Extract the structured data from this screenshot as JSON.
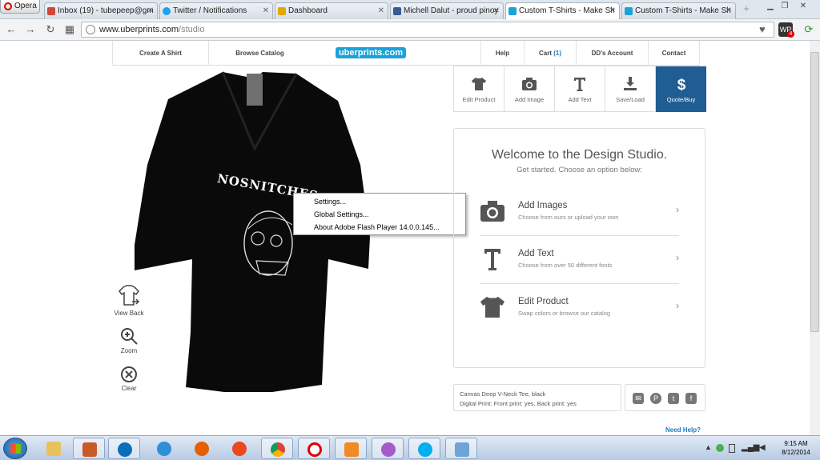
{
  "browser": {
    "menu_label": "Opera",
    "tabs": [
      {
        "title": "Inbox (19) - tubepeep@gm",
        "color": "#d44638"
      },
      {
        "title": "Twitter / Notifications",
        "color": "#1da1f2"
      },
      {
        "title": "Dashboard",
        "color": "#e0a800"
      },
      {
        "title": "Michell Dalut - proud pinoy",
        "color": "#3b5998"
      },
      {
        "title": "Custom T-Shirts - Make Sh",
        "color": "#1aa3d9"
      },
      {
        "title": "Custom T-Shirts - Make Sh",
        "color": "#1aa3d9"
      }
    ],
    "url_domain": "www.uberprints.com",
    "url_path": "/studio",
    "ext_label": "WP",
    "ext_badge": "4"
  },
  "site_nav": {
    "create": "Create A Shirt",
    "browse": "Browse Catalog",
    "logo": "uberprints.com",
    "help": "Help",
    "cart": "Cart",
    "cart_count": "(1)",
    "account": "DD's Account",
    "contact": "Contact"
  },
  "shirt": {
    "graphic_text": "NOSNITCHES.C"
  },
  "left_tools": {
    "view_back": "View Back",
    "zoom": "Zoom",
    "clear": "Clear"
  },
  "context_menu": {
    "items": [
      "Settings...",
      "Global Settings...",
      "About Adobe Flash Player 14.0.0.145..."
    ]
  },
  "tool_tabs": [
    {
      "label": "Edit Product"
    },
    {
      "label": "Add Image"
    },
    {
      "label": "Add Text"
    },
    {
      "label": "Save/Load"
    },
    {
      "label": "Quote/Buy"
    }
  ],
  "welcome": {
    "title": "Welcome to the Design Studio.",
    "subtitle": "Get started.  Choose an option below:",
    "options": [
      {
        "title": "Add Images",
        "desc": "Choose from ours or upload your own"
      },
      {
        "title": "Add Text",
        "desc": "Choose from over 50 different fonts"
      },
      {
        "title": "Edit Product",
        "desc": "Swap colors or browse our catalog"
      }
    ]
  },
  "product_info": {
    "name": "Canvas Deep V-Neck Tee, black",
    "print": "Digital Print:  Front print: yes, Back print: yes"
  },
  "need_help": "Need Help?",
  "taskbar": {
    "time": "9:15 AM",
    "date": "8/12/2014"
  },
  "colors": {
    "accent": "#1f5d93",
    "link": "#1a7fc1",
    "logo_bg": "#1aa3d9"
  }
}
